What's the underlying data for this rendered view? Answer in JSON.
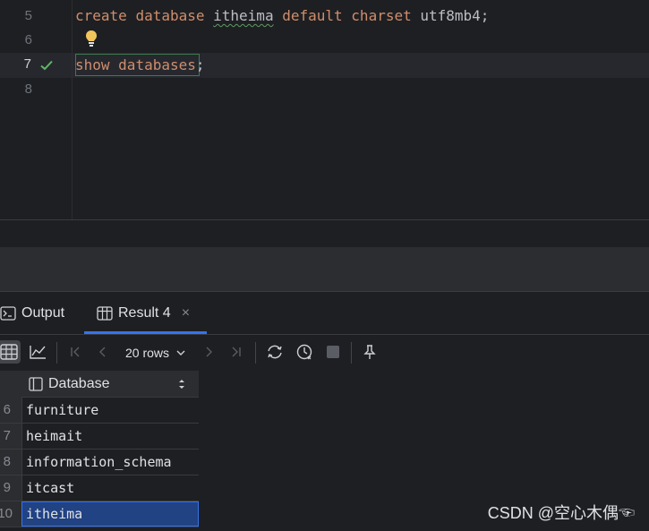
{
  "editor": {
    "lines": [
      {
        "number": "5",
        "tokens": [
          {
            "text": "create",
            "cls": "kw"
          },
          {
            "text": " ",
            "cls": "plain"
          },
          {
            "text": "database",
            "cls": "kw"
          },
          {
            "text": " ",
            "cls": "plain"
          },
          {
            "text": "itheima",
            "cls": "plain squig"
          },
          {
            "text": " ",
            "cls": "plain"
          },
          {
            "text": "default",
            "cls": "kw"
          },
          {
            "text": " ",
            "cls": "plain"
          },
          {
            "text": "charset",
            "cls": "kw"
          },
          {
            "text": " ",
            "cls": "plain"
          },
          {
            "text": "utf8mb4;",
            "cls": "plain"
          }
        ]
      },
      {
        "number": "6",
        "tokens": []
      },
      {
        "number": "7",
        "tokens": [
          {
            "text": "show",
            "cls": "kw"
          },
          {
            "text": " ",
            "cls": "plain"
          },
          {
            "text": "databases",
            "cls": "kw"
          },
          {
            "text": ";",
            "cls": "plain"
          }
        ]
      },
      {
        "number": "8",
        "tokens": []
      }
    ],
    "executed_line_icon": "checkmark-icon",
    "hint_icon": "lightbulb-icon"
  },
  "tabs": {
    "output_label": "Output",
    "result_label": "Result 4",
    "close_symbol": "×"
  },
  "toolbar": {
    "rows_label": "20 rows",
    "icons": [
      "table-view-icon",
      "chart-view-icon",
      "first-page-icon",
      "prev-page-icon",
      "next-page-icon",
      "last-page-icon",
      "reload-icon",
      "history-icon",
      "stop-icon",
      "pin-icon"
    ]
  },
  "grid": {
    "column": "Database",
    "rows": [
      {
        "n": "6",
        "value": "furniture"
      },
      {
        "n": "7",
        "value": "heimait"
      },
      {
        "n": "8",
        "value": "information_schema"
      },
      {
        "n": "9",
        "value": "itcast"
      },
      {
        "n": "10",
        "value": "itheima",
        "selected": true
      }
    ]
  },
  "watermark": "CSDN @空心木偶☜"
}
